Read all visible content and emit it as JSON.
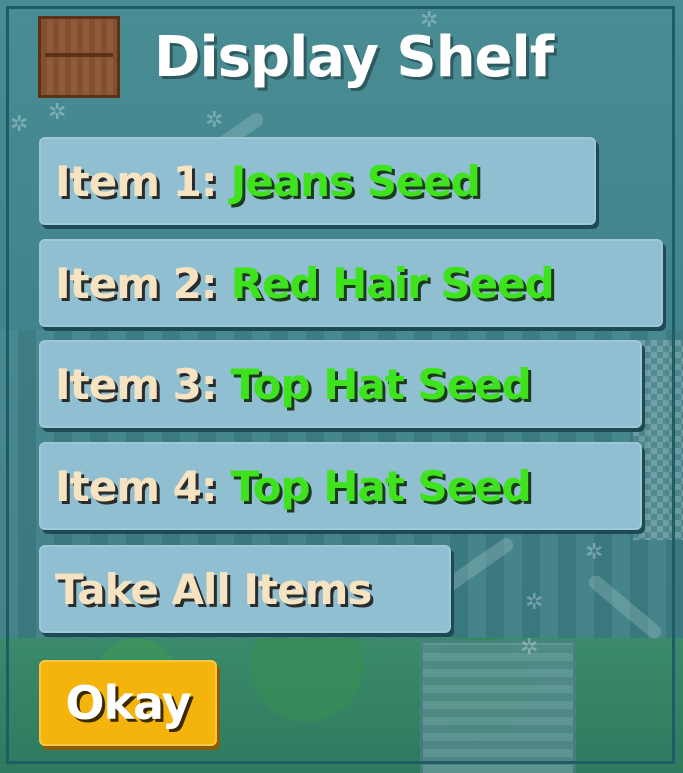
{
  "dialog": {
    "title": "Display Shelf",
    "title_icon": "display-shelf-icon"
  },
  "items": [
    {
      "label": "Item 1:",
      "value": "Jeans Seed"
    },
    {
      "label": "Item 2:",
      "value": "Red Hair Seed"
    },
    {
      "label": "Item 3:",
      "value": "Top Hat Seed"
    },
    {
      "label": "Item 4:",
      "value": "Top Hat Seed"
    }
  ],
  "actions": {
    "take_all_label": "Take All Items",
    "okay_label": "Okay"
  },
  "colors": {
    "button_bg": "#8fbfd1",
    "label_text": "#f6e3c1",
    "item_value_text": "#3fe31d",
    "okay_bg": "#f5b40b",
    "title_text": "#ffffff"
  }
}
